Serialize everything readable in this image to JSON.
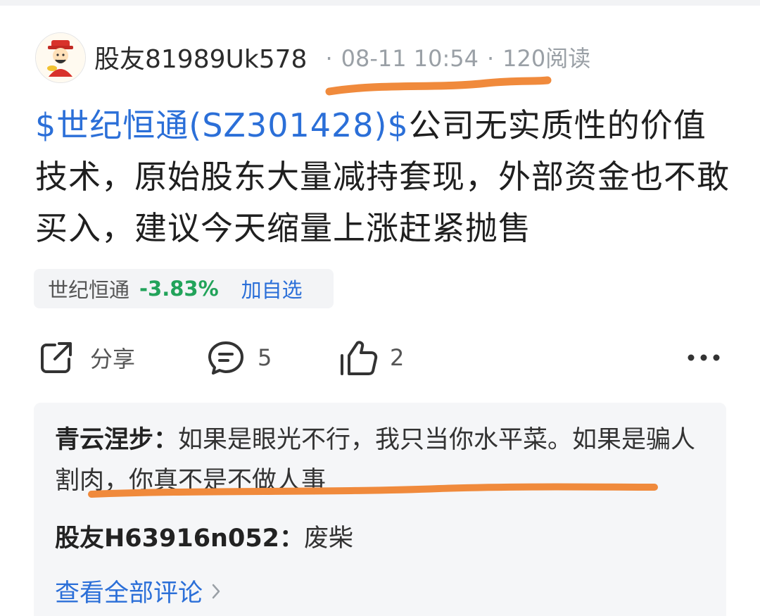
{
  "post": {
    "author": "股友81989Uk578",
    "date": "08-11 10:54",
    "separator": "·",
    "reads": "120阅读",
    "stock_tag": "$世纪恒通(SZ301428)$",
    "content": "公司无实质性的价值技术，原始股东大量减持套现，外部资金也不敢买入，建议今天缩量上涨赶紧抛售"
  },
  "stock_chip": {
    "name": "世纪恒通",
    "change": "-3.83%",
    "add_label": "加自选"
  },
  "actions": {
    "share_label": "分享",
    "comment_count": "5",
    "like_count": "2"
  },
  "comments": [
    {
      "name": "青云涅步：",
      "text": "如果是眼光不行，我只当你水平菜。如果是骗人割肉，你真不是不做人事"
    },
    {
      "name": "股友H63916n052：",
      "text": "废柴"
    }
  ],
  "view_all_label": "查看全部评论",
  "colors": {
    "link_blue": "#2b6fd8",
    "green_change": "#22a35a",
    "highlight_orange": "#f08a3c",
    "comment_bg": "#f5f6f8"
  },
  "icons": [
    "share-icon",
    "comment-icon",
    "like-icon",
    "more-icon",
    "chevron-right-icon"
  ]
}
